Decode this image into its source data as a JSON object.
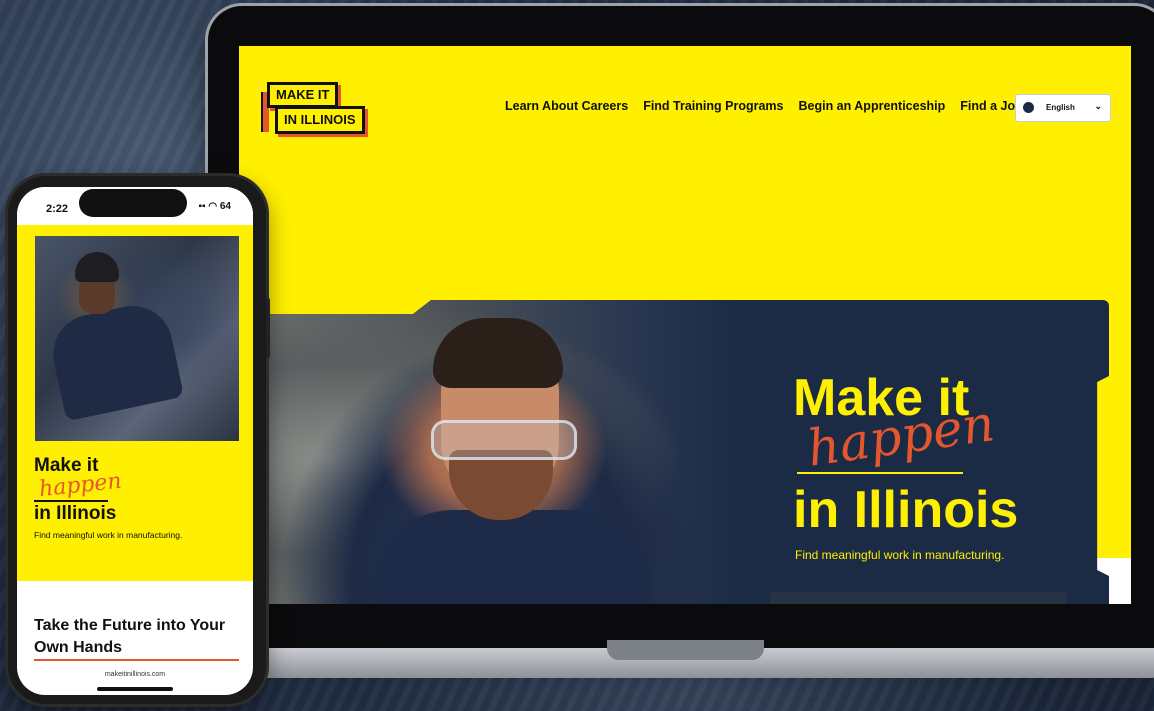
{
  "laptop_site": {
    "logo_line1": "MAKE IT",
    "logo_line2": "IN ILLINOIS",
    "nav": [
      "Learn About Careers",
      "Find Training Programs",
      "Begin an Apprenticeship",
      "Find a Job"
    ],
    "language": "English",
    "hero": {
      "title_line1": "Make it",
      "title_script": "happen",
      "title_line2": "in Illinois",
      "subtitle": "Find meaningful work in manufacturing."
    }
  },
  "phone_site": {
    "status_time": "2:22",
    "battery": "64",
    "hero": {
      "title_line1": "Make it",
      "title_script": "happen",
      "title_line2": "in Illinois",
      "subtitle": "Find meaningful work in manufacturing."
    },
    "section_heading": "Take the Future into Your Own Hands",
    "url": "makeitinillinois.com"
  },
  "colors": {
    "brand_yellow": "#ffef00",
    "accent_orange": "#e4572e",
    "navy": "#1b2a45"
  }
}
